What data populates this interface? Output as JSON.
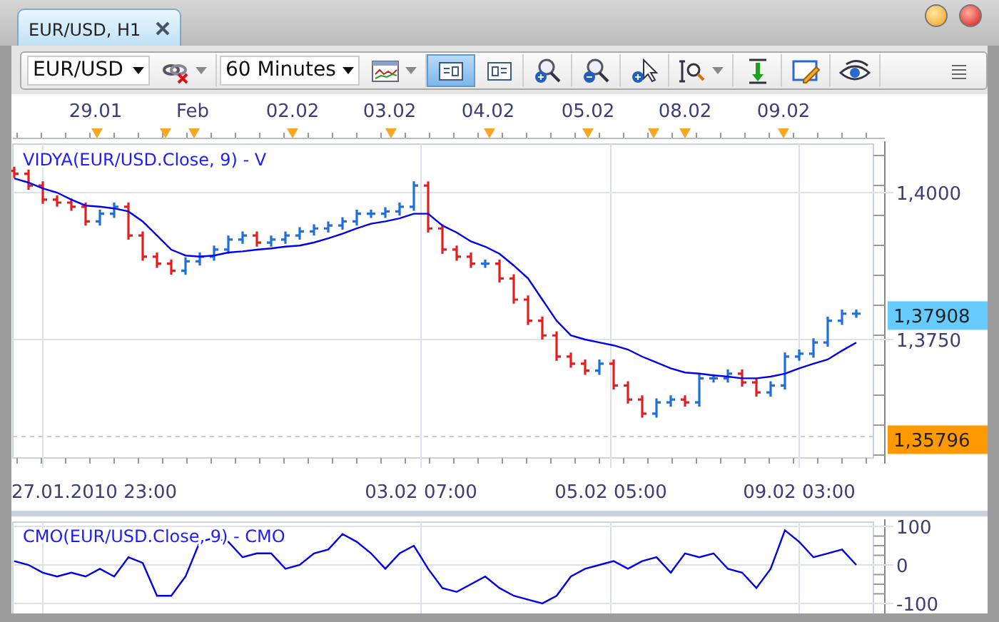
{
  "tab": {
    "label": "EUR/USD, H1",
    "selected": true
  },
  "window_buttons": [
    {
      "kind": "minimize"
    },
    {
      "kind": "close"
    }
  ],
  "toolbar": [
    {
      "kind": "symbol_select",
      "value": "EUR/USD"
    },
    {
      "kind": "connect",
      "dropdown": true,
      "selected": false
    },
    {
      "kind": "period_select",
      "value": "60 Minutes"
    },
    {
      "kind": "chart_type",
      "dropdown": true,
      "selected": false
    },
    {
      "kind": "panel_a",
      "dropdown": false,
      "selected": true
    },
    {
      "kind": "panel_b",
      "dropdown": false,
      "selected": false
    },
    {
      "kind": "zoom_in",
      "dropdown": false,
      "selected": false
    },
    {
      "kind": "zoom_out",
      "dropdown": false,
      "selected": false
    },
    {
      "kind": "zoom_cursor",
      "dropdown": false,
      "selected": false
    },
    {
      "kind": "zoom_range",
      "dropdown": true,
      "selected": false
    },
    {
      "kind": "measure",
      "dropdown": false,
      "selected": false
    },
    {
      "kind": "draw",
      "dropdown": false,
      "selected": false
    },
    {
      "kind": "view",
      "dropdown": false,
      "selected": false
    },
    {
      "kind": "more",
      "dropdown": false,
      "selected": false
    }
  ],
  "price_chart": {
    "legend": "VIDYA(EUR/USD.Close, 9) - V",
    "date_labels": [
      "29.01",
      "Feb",
      "02.02",
      "03.02",
      "04.02",
      "05.02",
      "08.02",
      "09.02"
    ],
    "price_labels": [
      "1,4000",
      "1,3750"
    ],
    "price_tags": [
      {
        "text": "1,37908",
        "color": "#66ccff"
      },
      {
        "text": "1,35796",
        "color": "#ff9900"
      }
    ],
    "time_labels": [
      "27.01.2010 23:00",
      "03.02 07:00",
      "05.02 05:00",
      "09.02 03:00"
    ]
  },
  "cmo_chart": {
    "chart_data": {
      "type": "line",
      "title": "CMO(EUR/USD.Close, 9) - CMO",
      "ylim": [
        -100,
        100
      ],
      "yticks": [
        100,
        0,
        -100
      ],
      "grid": true,
      "series": [
        {
          "color": "#0000ee",
          "values": [
            10,
            0,
            -20,
            -30,
            -20,
            -30,
            -10,
            -30,
            20,
            5,
            -80,
            -80,
            -30,
            60,
            70,
            60,
            20,
            30,
            30,
            -10,
            0,
            30,
            40,
            80,
            60,
            30,
            -10,
            30,
            50,
            -10,
            -60,
            -70,
            -50,
            -30,
            -60,
            -80,
            -90,
            -100,
            -80,
            -30,
            -10,
            0,
            10,
            -10,
            10,
            20,
            -20,
            30,
            20,
            30,
            -10,
            -20,
            -60,
            -10,
            90,
            60,
            20,
            30,
            40,
            0
          ]
        }
      ]
    }
  }
}
